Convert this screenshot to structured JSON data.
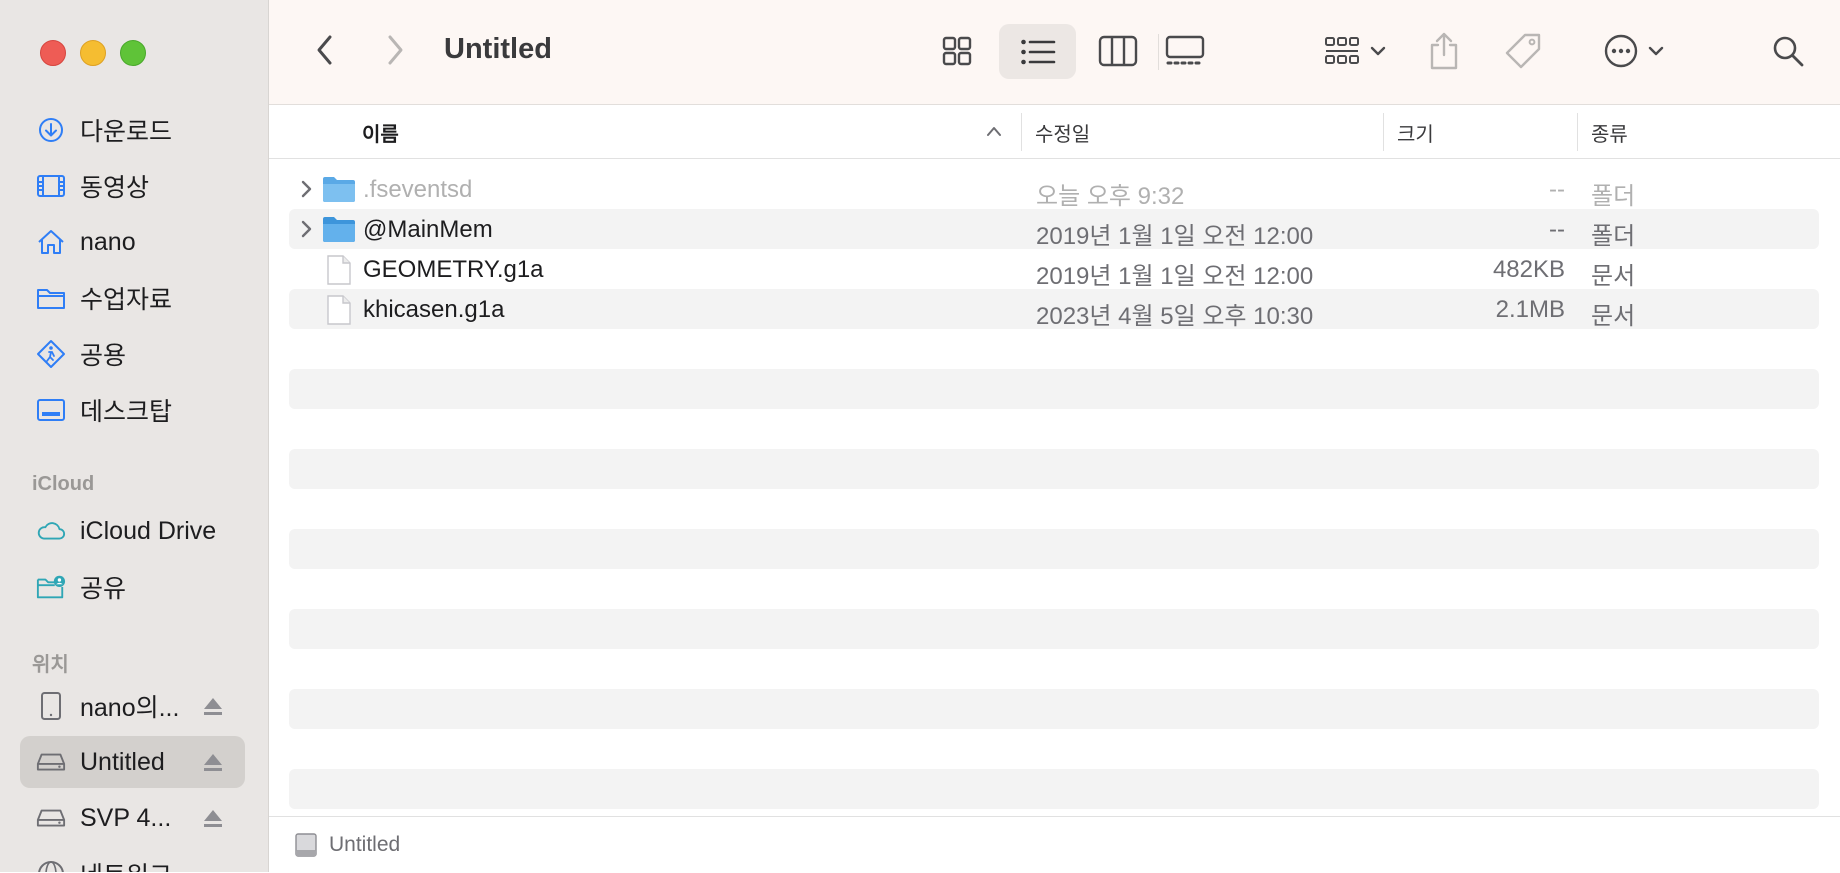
{
  "window": {
    "title": "Untitled"
  },
  "sidebar": {
    "favorites": [
      {
        "label": "다운로드",
        "icon": "download-icon"
      },
      {
        "label": "동영상",
        "icon": "film-icon"
      },
      {
        "label": "nano",
        "icon": "home-icon"
      },
      {
        "label": "수업자료",
        "icon": "folder-icon"
      },
      {
        "label": "공용",
        "icon": "public-icon"
      },
      {
        "label": "데스크탑",
        "icon": "desktop-icon"
      }
    ],
    "icloud_header": "iCloud",
    "icloud": [
      {
        "label": "iCloud Drive",
        "icon": "cloud-icon"
      },
      {
        "label": "공유",
        "icon": "shared-folder-icon"
      }
    ],
    "locations_header": "위치",
    "locations": [
      {
        "label": "nano의...",
        "icon": "ipad-icon",
        "selected": false
      },
      {
        "label": "Untitled",
        "icon": "drive-icon",
        "selected": true
      },
      {
        "label": "SVP 4...",
        "icon": "drive-icon",
        "selected": false
      },
      {
        "label": "네트워크",
        "icon": "network-icon",
        "selected": false
      }
    ]
  },
  "columns": {
    "name": "이름",
    "modified": "수정일",
    "size": "크기",
    "kind": "종류"
  },
  "files": [
    {
      "name": ".fseventsd",
      "modified": "오늘 오후 9:32",
      "size": "--",
      "kind": "폴더",
      "type": "folder",
      "dimmed": true
    },
    {
      "name": "@MainMem",
      "modified": "2019년 1월 1일 오전 12:00",
      "size": "--",
      "kind": "폴더",
      "type": "folder",
      "dimmed": false
    },
    {
      "name": "GEOMETRY.g1a",
      "modified": "2019년 1월 1일 오전 12:00",
      "size": "482KB",
      "kind": "문서",
      "type": "document",
      "dimmed": false
    },
    {
      "name": "khicasen.g1a",
      "modified": "2023년 4월 5일 오후 10:30",
      "size": "2.1MB",
      "kind": "문서",
      "type": "document",
      "dimmed": false
    }
  ],
  "statusbar": {
    "path": "Untitled"
  },
  "colors": {
    "sidebar_bg": "#e9e6e4",
    "toolbar_bg": "#fdf7f4",
    "accent": "#2f7ef6",
    "stripe": "#f3f3f3"
  }
}
